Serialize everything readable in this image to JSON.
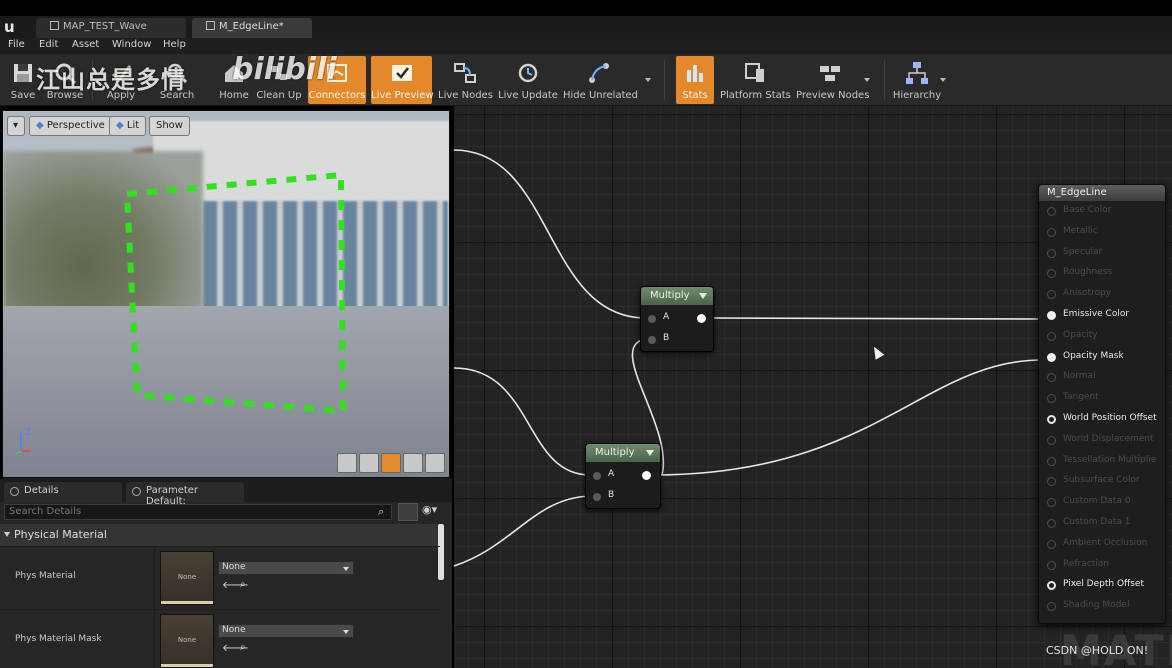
{
  "window": {
    "tabs": [
      {
        "label": "MAP_TEST_Wave"
      },
      {
        "label": "M_EdgeLine*"
      }
    ]
  },
  "menu": {
    "items": [
      "File",
      "Edit",
      "Asset",
      "Window",
      "Help"
    ]
  },
  "toolbar": {
    "buttons": [
      {
        "label": "Save",
        "icon": "save-icon"
      },
      {
        "label": "Browse",
        "icon": "browse-icon"
      },
      {
        "label": "Apply",
        "icon": "apply-icon"
      },
      {
        "label": "Search",
        "icon": "search-icon"
      },
      {
        "label": "Home",
        "icon": "home-icon"
      },
      {
        "label": "Clean Up",
        "icon": "clean-up-icon"
      },
      {
        "label": "Connectors",
        "icon": "connectors-icon",
        "active": true
      },
      {
        "label": "Live Preview",
        "icon": "live-preview-icon",
        "active": true
      },
      {
        "label": "Live Nodes",
        "icon": "live-nodes-icon"
      },
      {
        "label": "Live Update",
        "icon": "live-update-icon"
      },
      {
        "label": "Hide Unrelated",
        "icon": "hide-unrelated-icon"
      },
      {
        "label": "Stats",
        "icon": "stats-icon",
        "active": true
      },
      {
        "label": "Platform Stats",
        "icon": "platform-stats-icon"
      },
      {
        "label": "Preview Nodes",
        "icon": "preview-nodes-icon"
      },
      {
        "label": "Hierarchy",
        "icon": "hierarchy-icon"
      }
    ],
    "accent_color": "#e3892c"
  },
  "watermark": {
    "text": "江山总是多情",
    "logo": "bilibili"
  },
  "viewport": {
    "perspective_label": "Perspective",
    "lit_label": "Lit",
    "show_label": "Show",
    "axis_z": "Z",
    "selection_color": "#33e01e"
  },
  "details": {
    "tabs": [
      {
        "label": "Details"
      },
      {
        "label": "Parameter Default:"
      }
    ],
    "search_placeholder": "Search Details",
    "section_title": "Physical Material",
    "properties": [
      {
        "name": "Phys Material",
        "thumb_label": "None",
        "value": "None"
      },
      {
        "name": "Phys Material Mask",
        "thumb_label": "None",
        "value": "None"
      }
    ]
  },
  "graph": {
    "nodes": [
      {
        "title": "Multiply",
        "inputs": [
          "A",
          "B"
        ]
      },
      {
        "title": "Multiply",
        "inputs": [
          "A",
          "B"
        ]
      }
    ],
    "result_node": {
      "title": "M_EdgeLine",
      "pins": [
        {
          "label": "Base Color",
          "state": "dim"
        },
        {
          "label": "Metallic",
          "state": "dim"
        },
        {
          "label": "Specular",
          "state": "dim"
        },
        {
          "label": "Roughness",
          "state": "dim"
        },
        {
          "label": "Anisotropy",
          "state": "dim"
        },
        {
          "label": "Emissive Color",
          "state": "on"
        },
        {
          "label": "Opacity",
          "state": "dim"
        },
        {
          "label": "Opacity Mask",
          "state": "on"
        },
        {
          "label": "Normal",
          "state": "dim"
        },
        {
          "label": "Tangent",
          "state": "dim"
        },
        {
          "label": "World Position Offset",
          "state": "ring"
        },
        {
          "label": "World Displacement",
          "state": "dim"
        },
        {
          "label": "Tessellation Multiplie",
          "state": "dim"
        },
        {
          "label": "Subsurface Color",
          "state": "dim"
        },
        {
          "label": "Custom Data 0",
          "state": "dim"
        },
        {
          "label": "Custom Data 1",
          "state": "dim"
        },
        {
          "label": "Ambient Occlusion",
          "state": "dim"
        },
        {
          "label": "Refraction",
          "state": "dim"
        },
        {
          "label": "Pixel Depth Offset",
          "state": "ring"
        },
        {
          "label": "Shading Model",
          "state": "dim"
        }
      ]
    },
    "background_watermark": "MATE",
    "credit": "CSDN @HOLD ON!"
  }
}
